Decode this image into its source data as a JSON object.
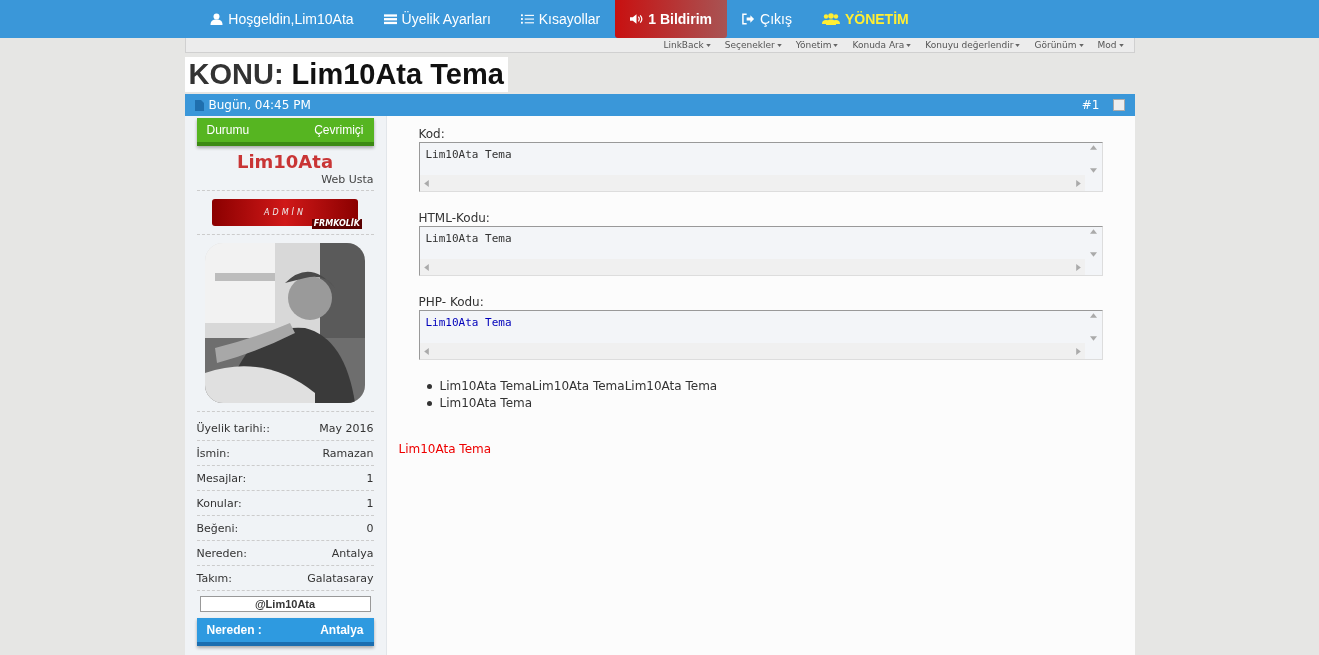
{
  "nav": [
    {
      "label": "Hoşgeldin,Lim10Ata",
      "kind": "normal"
    },
    {
      "label": "Üyelik Ayarları",
      "kind": "normal"
    },
    {
      "label": "Kısayollar",
      "kind": "normal"
    },
    {
      "label": "1 Bildirim",
      "kind": "alert"
    },
    {
      "label": "Çıkış",
      "kind": "normal"
    },
    {
      "label": "YÖNETİM",
      "kind": "admin"
    }
  ],
  "toolbar": [
    "LinkBack",
    "Seçenekler",
    "Yönetim",
    "Konuda Ara",
    "Konuyu değerlendir",
    "Görünüm",
    "Mod"
  ],
  "title": {
    "prefix": "KONU:",
    "text": "Lim10Ata Tema"
  },
  "post": {
    "date": "Bugün, 04:45 PM",
    "number": "#1",
    "checked": false
  },
  "profile": {
    "status_label": "Durumu",
    "status_value": "Çevrimiçi",
    "username": "Lim10Ata",
    "usertitle": "Web Usta",
    "rank": "ADMİN",
    "rank_tag": "FRMKOLİK",
    "stats": [
      {
        "label": "Üyelik tarihi::",
        "value": "May 2016"
      },
      {
        "label": "İsmin:",
        "value": "Ramazan"
      },
      {
        "label": "Mesajlar:",
        "value": "1"
      },
      {
        "label": "Konular:",
        "value": "1"
      },
      {
        "label": "Beğeni:",
        "value": "0"
      },
      {
        "label": "Nereden:",
        "value": "Antalya"
      },
      {
        "label": "Takım:",
        "value": "Galatasaray"
      }
    ],
    "handle": "@Lim10Ata",
    "location_label": "Nereden :",
    "location_value": "Antalya"
  },
  "code_blocks": [
    {
      "label": "Kod:",
      "code": "Lim10Ata Tema",
      "kind": "plain"
    },
    {
      "label": "HTML-Kodu:",
      "code": "Lim10Ata Tema",
      "kind": "plain"
    },
    {
      "label": "PHP- Kodu:",
      "code": "Lim10Ata Tema",
      "kind": "php"
    }
  ],
  "bullets": [
    "Lim10Ata TemaLim10Ata TemaLim10Ata Tema",
    "Lim10Ata Tema"
  ],
  "red_text": "Lim10Ata Tema"
}
